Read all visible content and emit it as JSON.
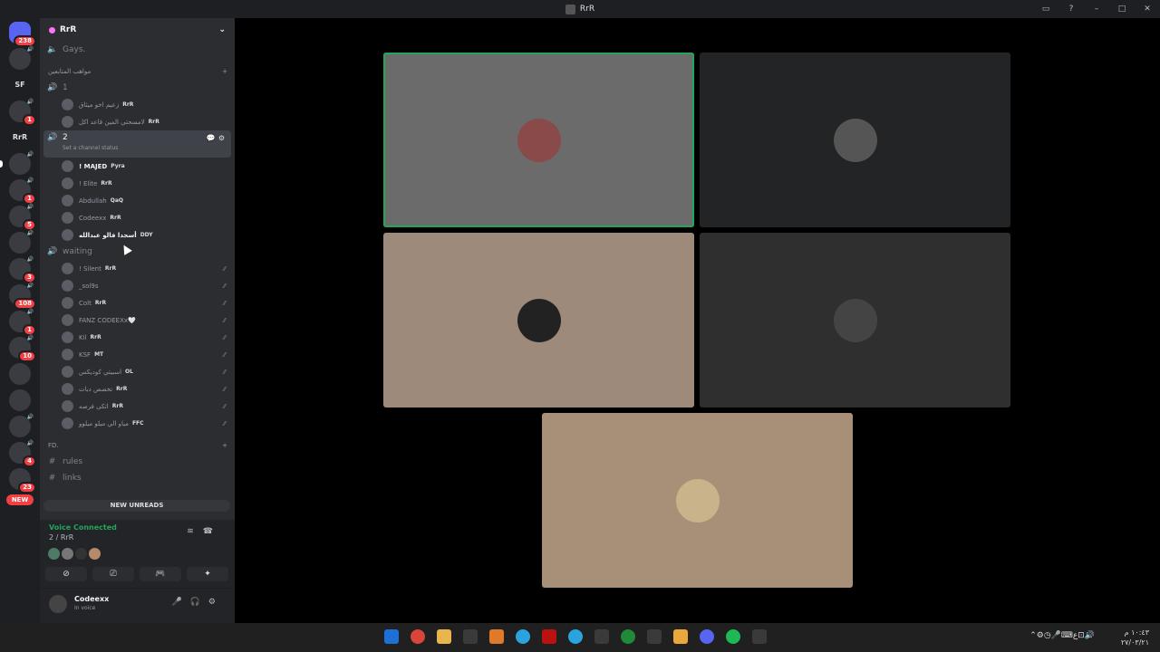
{
  "titlebar": {
    "title": "RrR"
  },
  "servers": [
    {
      "badge": "238",
      "kind": "home"
    },
    {
      "badge": "",
      "vol": true
    },
    {
      "badge": "",
      "text": "SF"
    },
    {
      "badge": "1",
      "vol": true
    },
    {
      "badge": "",
      "text": "RrR"
    },
    {
      "badge": "",
      "vol": true,
      "active": true
    },
    {
      "badge": "1",
      "vol": true
    },
    {
      "badge": "5",
      "vol": true
    },
    {
      "badge": "",
      "vol": true
    },
    {
      "badge": "3",
      "vol": true
    },
    {
      "badge": "108",
      "vol": true
    },
    {
      "badge": "1",
      "vol": true
    },
    {
      "badge": "10",
      "vol": true
    },
    {
      "badge": "",
      "vol": false
    },
    {
      "badge": "",
      "vol": false
    },
    {
      "badge": "",
      "vol": true
    },
    {
      "badge": "4",
      "vol": true
    },
    {
      "badge": "23",
      "vol": false
    },
    {
      "badge": "NEW",
      "kind": "new"
    }
  ],
  "guild": {
    "name": "RrR"
  },
  "channels": {
    "top_channel": "Gays.",
    "category1": "مواهب المتابعين",
    "voice1": {
      "name": "1",
      "members": [
        {
          "name": "زعيم اخو ميثاق",
          "tag": "RrR"
        },
        {
          "name": "لامسحتي المين قاعد اكل",
          "tag": "RrR"
        }
      ]
    },
    "voice2": {
      "name": "2",
      "status": "Set a channel status",
      "members": [
        {
          "name": "! MAJED",
          "tag": "Pyra",
          "bold": true
        },
        {
          "name": "! Elite",
          "tag": "RrR"
        },
        {
          "name": "Abdullah",
          "tag": "QaQ"
        },
        {
          "name": "Codeexx",
          "tag": "RrR"
        },
        {
          "name": "أسجدا فالو عبدالله",
          "tag": "DDY",
          "bold": true
        }
      ]
    },
    "waiting": {
      "name": "waiting",
      "members": [
        {
          "name": "! Silent",
          "tag": "RrR"
        },
        {
          "name": "_sol9s",
          "tag": ""
        },
        {
          "name": "Colt",
          "tag": "RrR"
        },
        {
          "name": "FANZ CODEEXx🤍",
          "tag": ""
        },
        {
          "name": "Kil",
          "tag": "RrR"
        },
        {
          "name": "KSF",
          "tag": "MT"
        },
        {
          "name": "اسبيتي كوديكس",
          "tag": "OL"
        },
        {
          "name": "تخصص دبات",
          "tag": "RrR"
        },
        {
          "name": "اتكى فرصه",
          "tag": "RrR"
        },
        {
          "name": "مياو الي ميلو ميلوو",
          "tag": "FFC"
        }
      ]
    },
    "category2": "FD.",
    "text_channels": [
      "rules",
      "links"
    ]
  },
  "new_unreads": "NEW UNREADS",
  "voice_panel": {
    "status": "Voice Connected",
    "channel": "2 / RrR"
  },
  "user_panel": {
    "name": "Codeexx",
    "status": "In voice"
  },
  "tiles": [
    {
      "bg": "#6b6b6b",
      "speaking": true,
      "avatar_color": "#8a4a4a"
    },
    {
      "bg": "#232425",
      "speaking": false,
      "avatar_color": "#555"
    },
    {
      "bg": "#9e8a7a",
      "speaking": false,
      "avatar_color": "#222"
    },
    {
      "bg": "#2f2f2f",
      "speaking": false,
      "avatar_color": "#444"
    },
    {
      "bg": "#a89078",
      "speaking": false,
      "avatar_color": "#c8b48a"
    }
  ],
  "taskbar": {
    "time": "١٠:٤٣ م",
    "date": "٢٧/٠٣/٢١"
  }
}
